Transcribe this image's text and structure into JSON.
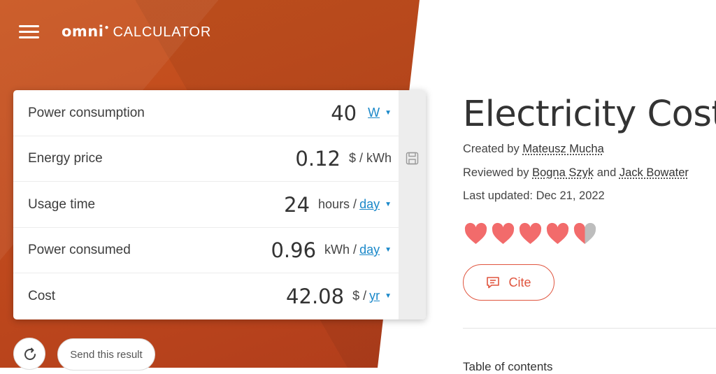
{
  "header": {
    "logo_omni": "omni",
    "logo_calculator": "CALCULATOR"
  },
  "calculator": {
    "rows": [
      {
        "label": "Power consumption",
        "value": "40",
        "unit_prefix": "",
        "unit_link": "W"
      },
      {
        "label": "Energy price",
        "value": "0.12",
        "unit_prefix": "$ / kWh",
        "unit_link": ""
      },
      {
        "label": "Usage time",
        "value": "24",
        "unit_prefix": "hours /",
        "unit_link": "day"
      },
      {
        "label": "Power consumed",
        "value": "0.96",
        "unit_prefix": "kWh /",
        "unit_link": "day"
      },
      {
        "label": "Cost",
        "value": "42.08",
        "unit_prefix": "$ /",
        "unit_link": "yr"
      }
    ]
  },
  "actions": {
    "send_label": "Send this result"
  },
  "article": {
    "title": "Electricity Cost",
    "created_prefix": "Created by",
    "creator": "Mateusz Mucha",
    "reviewed_prefix": "Reviewed by",
    "reviewer1": "Bogna Szyk",
    "and": "and",
    "reviewer2": "Jack Bowater",
    "updated": "Last updated: Dec 21, 2022",
    "rating": 4.5,
    "rating_max": 5,
    "cite_label": "Cite",
    "toc_label": "Table of contents"
  },
  "colors": {
    "accent": "#e0553f",
    "link": "#1a88c9",
    "heart": "#f26b6b",
    "heart_empty": "#bdbdbd"
  }
}
